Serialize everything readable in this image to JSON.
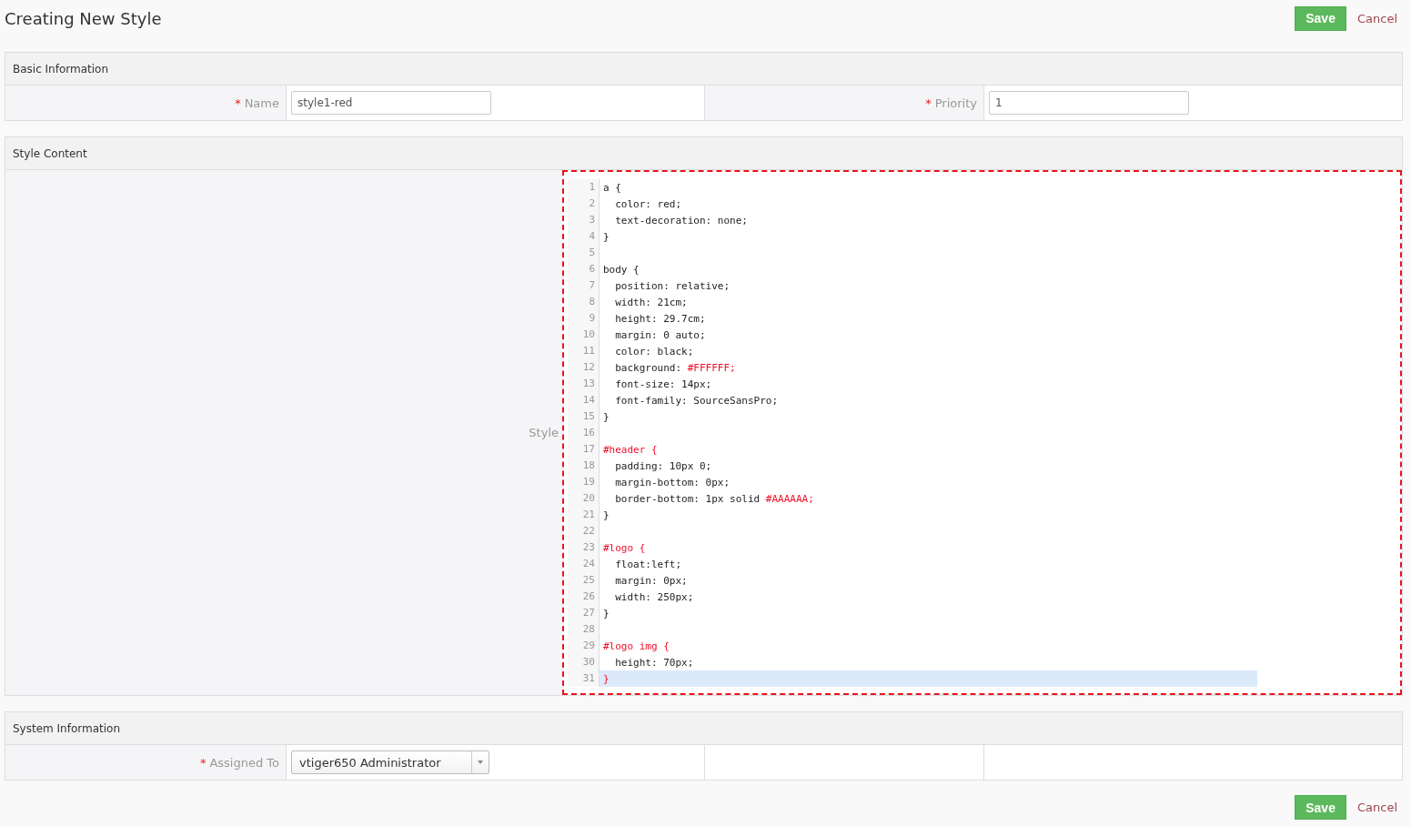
{
  "page_title": "Creating New Style",
  "header_actions": {
    "save": "Save",
    "cancel": "Cancel"
  },
  "sections": [
    {
      "kind": "fields",
      "title": "Basic Information",
      "fields": [
        {
          "kind": "text",
          "label": "Name",
          "required_mark": "*",
          "value": "style1-red"
        },
        {
          "kind": "text",
          "label": "Priority",
          "required_mark": "*",
          "value": "1"
        }
      ]
    },
    {
      "kind": "editor",
      "title": "Style Content",
      "label": "Style",
      "lines": [
        {
          "number": "1",
          "active": false,
          "segments": [
            {
              "text": "a {",
              "kind": "plain"
            }
          ]
        },
        {
          "number": "2",
          "active": false,
          "segments": [
            {
              "text": "  color: red;",
              "kind": "plain"
            }
          ]
        },
        {
          "number": "3",
          "active": false,
          "segments": [
            {
              "text": "  text-decoration: none;",
              "kind": "plain"
            }
          ]
        },
        {
          "number": "4",
          "active": false,
          "segments": [
            {
              "text": "}",
              "kind": "plain"
            }
          ]
        },
        {
          "number": "5",
          "active": false
        },
        {
          "number": "6",
          "active": false,
          "segments": [
            {
              "text": "body {",
              "kind": "plain"
            }
          ]
        },
        {
          "number": "7",
          "active": false,
          "segments": [
            {
              "text": "  position: relative;",
              "kind": "plain"
            }
          ]
        },
        {
          "number": "8",
          "active": false,
          "segments": [
            {
              "text": "  width: 21cm;",
              "kind": "plain"
            }
          ]
        },
        {
          "number": "9",
          "active": false,
          "segments": [
            {
              "text": "  height: 29.7cm;",
              "kind": "plain"
            }
          ]
        },
        {
          "number": "10",
          "active": false,
          "segments": [
            {
              "text": "  margin: 0 auto;",
              "kind": "plain"
            }
          ]
        },
        {
          "number": "11",
          "active": false,
          "segments": [
            {
              "text": "  color: black;",
              "kind": "plain"
            }
          ]
        },
        {
          "number": "12",
          "active": false,
          "segments": [
            {
              "text": "  background: ",
              "kind": "plain"
            },
            {
              "text": "#FFFFFF;",
              "kind": "hash"
            }
          ]
        },
        {
          "number": "13",
          "active": false,
          "segments": [
            {
              "text": "  font-size: 14px;",
              "kind": "plain"
            }
          ]
        },
        {
          "number": "14",
          "active": false,
          "segments": [
            {
              "text": "  font-family: SourceSansPro;",
              "kind": "plain"
            }
          ]
        },
        {
          "number": "15",
          "active": false,
          "segments": [
            {
              "text": "}",
              "kind": "plain"
            }
          ]
        },
        {
          "number": "16",
          "active": false
        },
        {
          "number": "17",
          "active": false,
          "segments": [
            {
              "text": "#header {",
              "kind": "hash"
            }
          ]
        },
        {
          "number": "18",
          "active": false,
          "segments": [
            {
              "text": "  padding: 10px 0;",
              "kind": "plain"
            }
          ]
        },
        {
          "number": "19",
          "active": false,
          "segments": [
            {
              "text": "  margin-bottom: 0px;",
              "kind": "plain"
            }
          ]
        },
        {
          "number": "20",
          "active": false,
          "segments": [
            {
              "text": "  border-bottom: 1px solid ",
              "kind": "plain"
            },
            {
              "text": "#AAAAAA;",
              "kind": "hash"
            }
          ]
        },
        {
          "number": "21",
          "active": false,
          "segments": [
            {
              "text": "}",
              "kind": "plain"
            }
          ]
        },
        {
          "number": "22",
          "active": false
        },
        {
          "number": "23",
          "active": false,
          "segments": [
            {
              "text": "#logo {",
              "kind": "hash"
            }
          ]
        },
        {
          "number": "24",
          "active": false,
          "segments": [
            {
              "text": "  float:left;",
              "kind": "plain"
            }
          ]
        },
        {
          "number": "25",
          "active": false,
          "segments": [
            {
              "text": "  margin: 0px;",
              "kind": "plain"
            }
          ]
        },
        {
          "number": "26",
          "active": false,
          "segments": [
            {
              "text": "  width: 250px;",
              "kind": "plain"
            }
          ]
        },
        {
          "number": "27",
          "active": false,
          "segments": [
            {
              "text": "}",
              "kind": "plain"
            }
          ]
        },
        {
          "number": "28",
          "active": false
        },
        {
          "number": "29",
          "active": false,
          "segments": [
            {
              "text": "#logo img {",
              "kind": "hash"
            }
          ]
        },
        {
          "number": "30",
          "active": false,
          "segments": [
            {
              "text": "  height: 70px;",
              "kind": "plain"
            }
          ]
        },
        {
          "number": "31",
          "active": true,
          "segments": [
            {
              "text": "}",
              "kind": "hash"
            }
          ]
        }
      ]
    },
    {
      "kind": "fields",
      "title": "System Information",
      "fields": [
        {
          "kind": "select",
          "label": "Assigned To",
          "required_mark": "*",
          "value": "vtiger650 Administrator"
        }
      ]
    }
  ],
  "footer_actions": {
    "save": "Save",
    "cancel": "Cancel"
  }
}
